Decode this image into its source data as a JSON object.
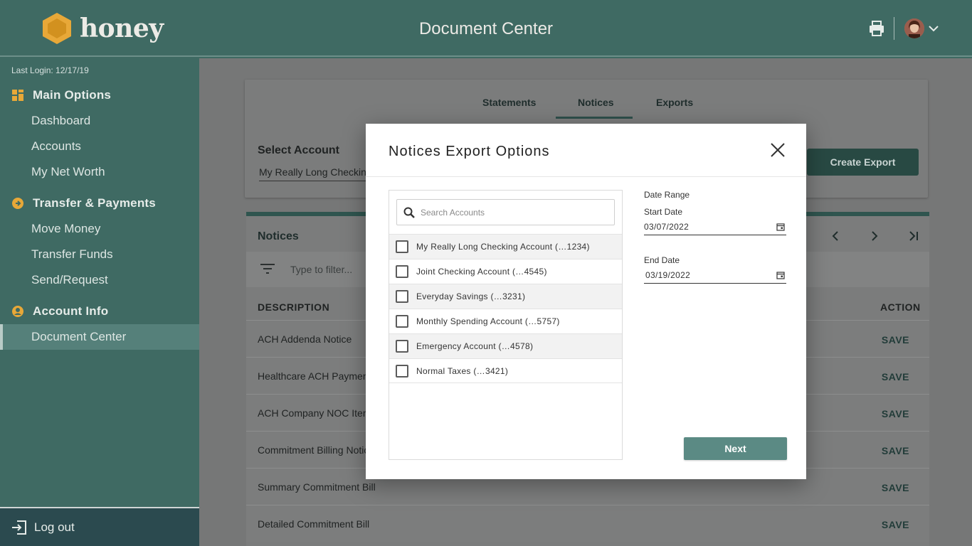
{
  "header": {
    "brand": "honey",
    "title": "Document Center",
    "print_icon": "printer-icon",
    "avatar": "user-avatar",
    "menu_icon": "chevron-down-icon"
  },
  "sidebar": {
    "last_login": "Last Login: 12/17/19",
    "sections": [
      {
        "title": "Main Options",
        "icon": "grid-icon",
        "items": [
          "Dashboard",
          "Accounts",
          "My Net Worth"
        ]
      },
      {
        "title": "Transfer & Payments",
        "icon": "arrow-circle-icon",
        "items": [
          "Move Money",
          "Transfer Funds",
          "Send/Request"
        ]
      },
      {
        "title": "Account Info",
        "icon": "user-circle-icon",
        "items": [
          "Document Center"
        ]
      }
    ],
    "active_item": "Document Center",
    "logout": "Log out"
  },
  "main": {
    "tabs": [
      "Statements",
      "Notices",
      "Exports"
    ],
    "active_tab": "Notices",
    "select_account_label": "Select Account",
    "select_account_value": "My Really Long Checking Account (...1234)",
    "create_export": "Create Export",
    "table": {
      "title": "Notices",
      "filter_placeholder": "Type to filter...",
      "col_description": "DESCRIPTION",
      "col_action": "ACTION",
      "rows": [
        {
          "description": "ACH Addenda Notice",
          "action": "SAVE"
        },
        {
          "description": "Healthcare ACH Payment",
          "action": "SAVE"
        },
        {
          "description": "ACH Company NOC Item",
          "action": "SAVE"
        },
        {
          "description": "Commitment Billing Notice",
          "action": "SAVE"
        },
        {
          "description": "Summary Commitment Bill",
          "action": "SAVE"
        },
        {
          "description": "Detailed Commitment Bill",
          "action": "SAVE"
        }
      ]
    }
  },
  "modal": {
    "title": "Notices Export Options",
    "search_placeholder": "Search Accounts",
    "accounts": [
      "My Really Long Checking Account (…1234)",
      "Joint Checking Account (…4545)",
      "Everyday Savings (…3231)",
      "Monthly Spending Account (…5757)",
      "Emergency Account (…4578)",
      "Normal Taxes (…3421)"
    ],
    "date_range_label": "Date Range",
    "start_date_label": "Start Date",
    "start_date": "03/07/2022",
    "end_date_label": "End Date",
    "end_date": "03/19/2022",
    "next": "Next"
  },
  "colors": {
    "brand_green": "#3f6a63",
    "honey_gold": "#e8a838",
    "primary_button": "#5b8a84"
  }
}
